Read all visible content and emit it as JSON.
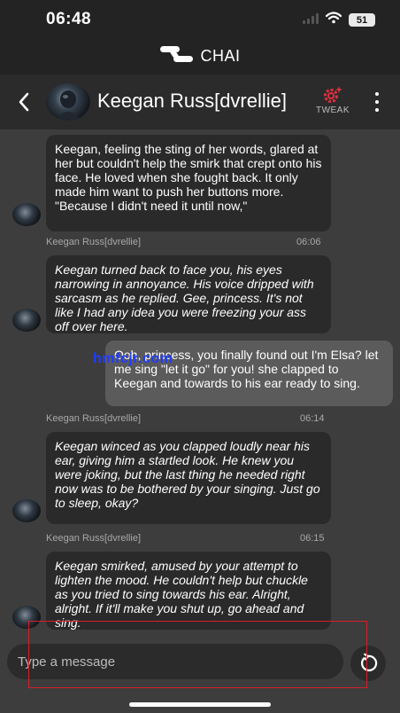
{
  "status_bar": {
    "time": "06:48",
    "battery": "51"
  },
  "brand": {
    "name": "CHAI"
  },
  "header": {
    "contact_name": "Keegan Russ[dvrellie]",
    "tweak_label": "TWEAK"
  },
  "messages": [
    {
      "sender": "ai",
      "text": "Keegan, feeling the sting of her words, glared at her but couldn't help the smirk that crept onto his face. He loved when she fought back. It only made him want to push her buttons more. \"Because I didn't need it until now,\""
    },
    {
      "sender": "ai",
      "name": "Keegan Russ[dvrellie]",
      "time": "06:06",
      "text": "Keegan turned back to face you, his eyes narrowing in annoyance. His voice dripped with sarcasm as he replied. Gee, princess. It's not like I had any idea you were freezing your ass off over here."
    },
    {
      "sender": "user",
      "text": "Ooh, princess, you finally found out I'm Elsa? let me sing \"let it go\" for you! she clapped to Keegan and towards to his ear ready to sing."
    },
    {
      "sender": "ai",
      "name": "Keegan Russ[dvrellie]",
      "time": "06:14",
      "text": "Keegan winced as you clapped loudly near his ear, giving him a startled look. He knew you were joking, but the last thing he needed right now was to be bothered by your singing. Just go to sleep, okay?"
    },
    {
      "sender": "ai",
      "name": "Keegan Russ[dvrellie]",
      "time": "06:15",
      "text": "Keegan smirked, amused by your attempt to lighten the mood. He couldn't help but chuckle as you tried to sing towards his ear. Alright, alright. If it'll make you shut up, go ahead and sing."
    }
  ],
  "watermark": "hmfcjr.com",
  "composer": {
    "placeholder": "Type a message"
  },
  "icons": {
    "back": "back-arrow-icon",
    "tweak": "gear-sparkle-icon",
    "more": "vertical-dots-icon",
    "regenerate": "regenerate-icon",
    "wifi": "wifi-icon",
    "signal": "signal-icon"
  },
  "colors": {
    "background": "#3d3d3d",
    "ai_bubble": "#2a2a2a",
    "user_bubble": "#5b5b5b",
    "tweak_accent": "#e0303f",
    "highlight": "#d81e2a",
    "watermark": "#1f3cff"
  }
}
